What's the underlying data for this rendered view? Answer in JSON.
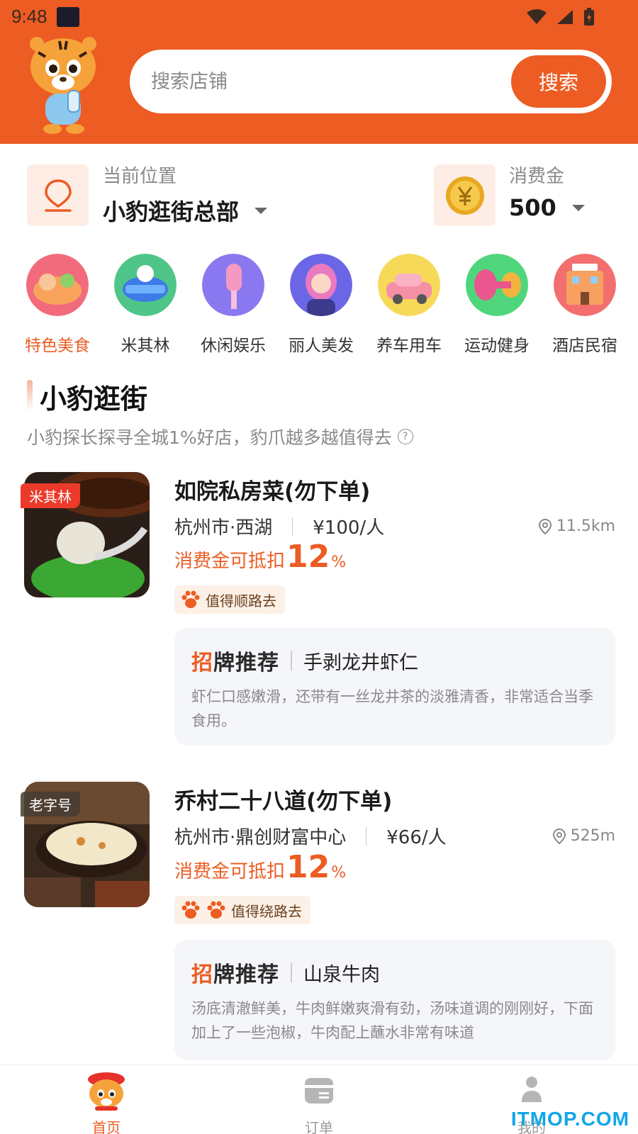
{
  "status_bar": {
    "time": "9:48"
  },
  "search": {
    "placeholder": "搜索店铺",
    "button_label": "搜索"
  },
  "location": {
    "label": "当前位置",
    "value": "小豹逛街总部"
  },
  "credit": {
    "label": "消费金",
    "value": "500"
  },
  "categories": [
    {
      "label": "特色美食",
      "icon": "food-icon",
      "active": true
    },
    {
      "label": "米其林",
      "icon": "michelin-icon"
    },
    {
      "label": "休闲娱乐",
      "icon": "microphone-icon"
    },
    {
      "label": "丽人美发",
      "icon": "beauty-icon"
    },
    {
      "label": "养车用车",
      "icon": "car-icon"
    },
    {
      "label": "运动健身",
      "icon": "dumbbell-icon"
    },
    {
      "label": "酒店民宿",
      "icon": "hotel-icon"
    }
  ],
  "section": {
    "title": "小豹逛街",
    "subtitle": "小豹探长探寻全城1%好店，豹爪越多越值得去"
  },
  "shops": [
    {
      "badge": "米其林",
      "name": "如院私房菜(勿下单)",
      "area": "杭州市·西湖",
      "price": "¥100/人",
      "distance": "11.5km",
      "discount_text": "消费金可抵扣",
      "discount_value": "12",
      "discount_unit": "%",
      "paw_count": 1,
      "paw_label": "值得顺路去",
      "rec_tag_first": "招",
      "rec_tag_rest": "牌推荐",
      "dish": "手剥龙井虾仁",
      "desc": "虾仁口感嫩滑，还带有一丝龙井茶的淡雅清香，非常适合当季食用。"
    },
    {
      "badge": "老字号",
      "name": "乔村二十八道(勿下单)",
      "area": "杭州市·鼎创财富中心",
      "price": "¥66/人",
      "distance": "525m",
      "discount_text": "消费金可抵扣",
      "discount_value": "12",
      "discount_unit": "%",
      "paw_count": 2,
      "paw_label": "值得绕路去",
      "rec_tag_first": "招",
      "rec_tag_rest": "牌推荐",
      "dish": "山泉牛肉",
      "desc": "汤底清澈鲜美，牛肉鲜嫩爽滑有劲，汤味道调的刚刚好，下面加上了一些泡椒，牛肉配上蘸水非常有味道"
    }
  ],
  "bottom_nav": [
    {
      "label": "首页",
      "icon": "mascot-home-icon",
      "active": true
    },
    {
      "label": "订单",
      "icon": "order-icon"
    },
    {
      "label": "我的",
      "icon": "user-icon"
    }
  ],
  "watermark": "ITMOP.COM",
  "colors": {
    "accent": "#EC5C23",
    "card_bg": "#F5F6FA",
    "tag_bg": "#FDF1E7"
  }
}
